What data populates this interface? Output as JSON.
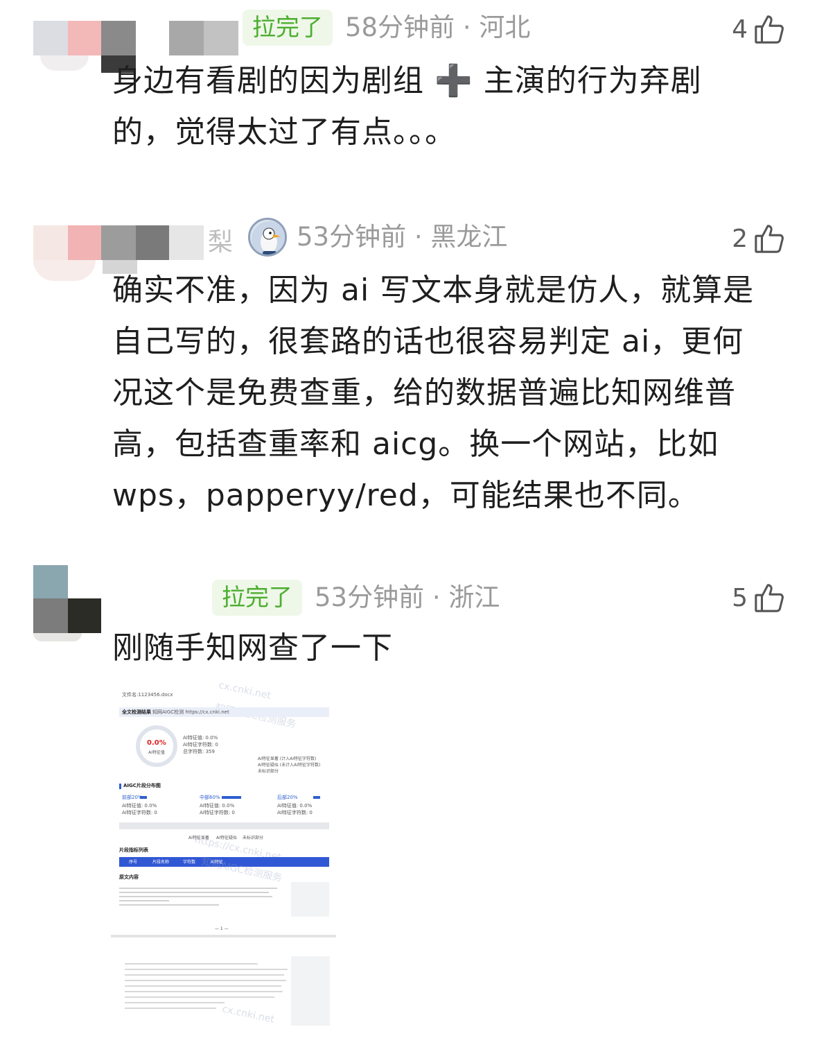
{
  "comments": [
    {
      "tag": "拉完了",
      "time": "58分钟前 · 河北",
      "likes": "4",
      "text_lines": [
        "身边有看剧的因为剧组 ➕ 主演的行为弃剧",
        "的，觉得太过了有点。。。"
      ]
    },
    {
      "name_fragment": "梨",
      "time": "53分钟前 · 黑龙江",
      "likes": "2",
      "text_lines": [
        "确实不准，因为 ai 写文本身就是仿人，就算是",
        "自己写的，很套路的话也很容易判定 ai，更何",
        "况这个是免费查重，给的数据普遍比知网维普",
        "高，包括查重率和 aicg。换一个网站，比如",
        " wps，papperyy/red，可能结果也不同。"
      ]
    },
    {
      "tag": "拉完了",
      "time": "53分钟前 · 浙江",
      "likes": "5",
      "text_lines": [
        "刚随手知网查了一下"
      ]
    }
  ],
  "report": {
    "filename": "文件名:1123456.docx",
    "section_title": "全文检测结果",
    "service": "知网AIGC检测  https://cx.cnki.net",
    "score": "0.0%",
    "score_label": "AI特征值",
    "stats": [
      "AI特征值: 0.0%",
      "AI特征字符数: 0",
      "总字符数: 359"
    ],
    "legend": [
      "AI特征显著 (计入AI特征字符数)",
      "AI特征疑似 (未计入AI特征字符数)",
      "未标识部分"
    ],
    "distribution_title": "AIGC片段分布图",
    "segments": [
      {
        "label": "前部20%",
        "val": "AI特征值: 0.0%",
        "chars": "AI特征字符数: 0"
      },
      {
        "label": "中部60%",
        "val": "AI特征值: 0.0%",
        "chars": "AI特征字符数: 0"
      },
      {
        "label": "后部20%",
        "val": "AI特征值: 0.0%",
        "chars": "AI特征字符数: 0"
      }
    ],
    "legend2": [
      "AI特征显著",
      "AI特征疑似",
      "未标识部分"
    ],
    "table_title": "片段指标列表",
    "table_headers": [
      "序号",
      "片段名称",
      "字符数",
      "AI特征"
    ],
    "original_title": "原文内容",
    "page_num": "— 1 —",
    "watermark1": "cx.cnki.net",
    "watermark2": "知网AIGC检测服务",
    "watermark3": "https://cx.cnki.net"
  }
}
